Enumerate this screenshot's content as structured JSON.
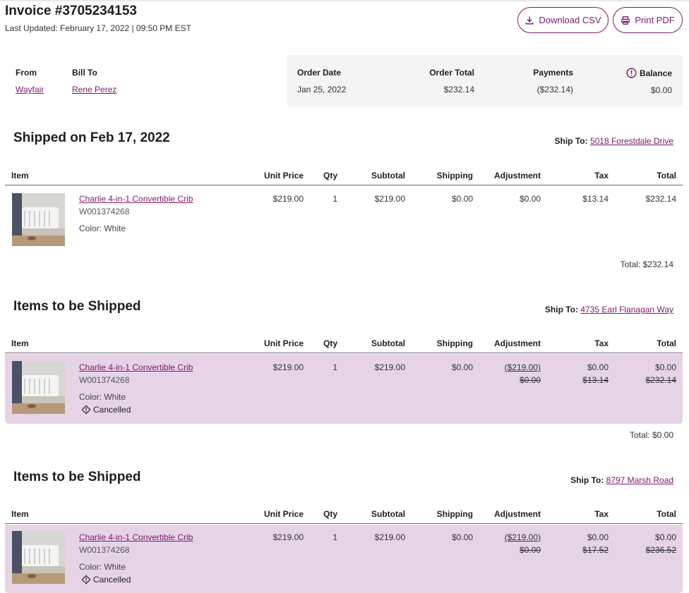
{
  "header": {
    "title": "Invoice #3705234153",
    "last_updated": "Last Updated: February 17, 2022 | 09:50 PM EST",
    "download_csv": "Download CSV",
    "print_pdf": "Print PDF"
  },
  "parties": {
    "from_label": "From",
    "from_value": "Wayfair",
    "bill_to_label": "Bill To",
    "bill_to_value": "Rene Perez"
  },
  "summary": {
    "order_date_label": "Order Date",
    "order_date": "Jan 25, 2022",
    "order_total_label": "Order Total",
    "order_total": "$232.14",
    "payments_label": "Payments",
    "payments": "($232.14)",
    "balance_label": "Balance",
    "balance": "$0.00"
  },
  "columns": [
    "Item",
    "Unit Price",
    "Qty",
    "Subtotal",
    "Shipping",
    "Adjustment",
    "Tax",
    "Total"
  ],
  "ship_to_label": "Ship To:",
  "sections": [
    {
      "title": "Shipped on Feb 17, 2022",
      "ship_to": "5018 Forestdale Drive",
      "item": {
        "name": "Charlie 4-in-1 Convertible Crib",
        "sku": "W001374268",
        "color": "Color: White",
        "status": "",
        "unit_price": "$219.00",
        "qty": "1",
        "subtotal": "$219.00",
        "shipping": "$0.00",
        "adjustment": "$0.00",
        "adjustment_old": "",
        "tax": "$13.14",
        "tax_old": "",
        "total": "$232.14",
        "total_old": ""
      },
      "total_line": "Total: $232.14"
    },
    {
      "title": "Items to be Shipped",
      "ship_to": "4735 Earl Flanagan Way",
      "item": {
        "name": "Charlie 4-in-1 Convertible Crib",
        "sku": "W001374268",
        "color": "Color: White",
        "status": "Cancelled",
        "unit_price": "$219.00",
        "qty": "1",
        "subtotal": "$219.00",
        "shipping": "$0.00",
        "adjustment": "($219.00)",
        "adjustment_old": "$0.00",
        "tax": "$0.00",
        "tax_old": "$13.14",
        "total": "$0.00",
        "total_old": "$232.14"
      },
      "total_line": "Total: $0.00"
    },
    {
      "title": "Items to be Shipped",
      "ship_to": "8797 Marsh Road",
      "item": {
        "name": "Charlie 4-in-1 Convertible Crib",
        "sku": "W001374268",
        "color": "Color: White",
        "status": "Cancelled",
        "unit_price": "$219.00",
        "qty": "1",
        "subtotal": "$219.00",
        "shipping": "$0.00",
        "adjustment": "($219.00)",
        "adjustment_old": "$0.00",
        "tax": "$0.00",
        "tax_old": "$17.52",
        "total": "$0.00",
        "total_old": "$236.52"
      },
      "total_line": ""
    }
  ],
  "icons": {
    "download": "download-icon",
    "print": "printer-icon",
    "info": "info-icon",
    "status": "cancelled-icon",
    "thumbnail": "crib-thumbnail"
  },
  "colors": {
    "accent": "#7b1a6b",
    "cancel_row": "#e6d4e6",
    "summary_bg": "#f4f4f4"
  }
}
